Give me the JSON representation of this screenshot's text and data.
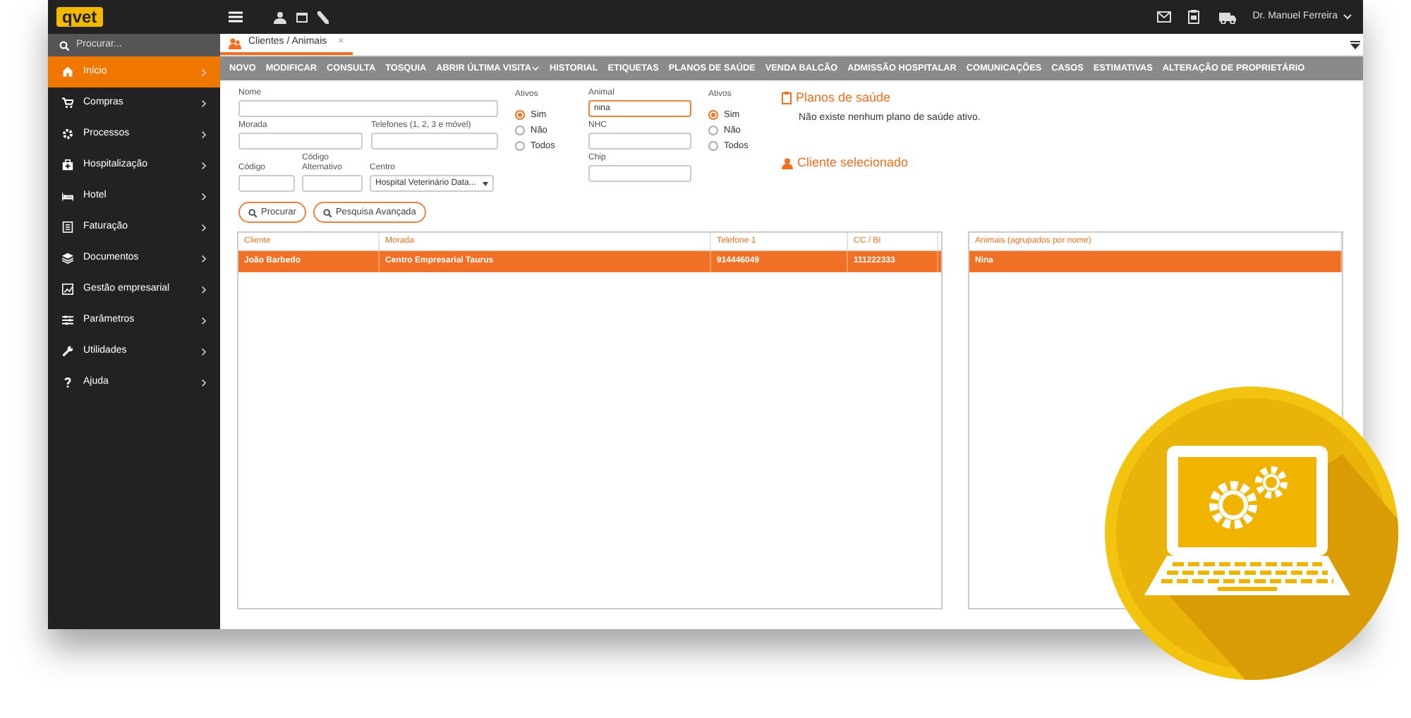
{
  "header": {
    "logo": "qvet",
    "user": "Dr. Manuel Ferreira"
  },
  "sidebar": {
    "search_placeholder": "Procurar...",
    "items": [
      {
        "label": "Início",
        "selected": true
      },
      {
        "label": "Compras",
        "selected": false
      },
      {
        "label": "Processos",
        "selected": false
      },
      {
        "label": "Hospitalização",
        "selected": false
      },
      {
        "label": "Hotel",
        "selected": false
      },
      {
        "label": "Faturação",
        "selected": false
      },
      {
        "label": "Documentos",
        "selected": false
      },
      {
        "label": "Gestão empresarial",
        "selected": false
      },
      {
        "label": "Parâmetros",
        "selected": false
      },
      {
        "label": "Utilidades",
        "selected": false
      },
      {
        "label": "Ajuda",
        "selected": false
      }
    ]
  },
  "tab": {
    "label": "Clientes / Animais",
    "close": "×"
  },
  "toolbar": [
    {
      "label": "NOVO",
      "dropdown": false
    },
    {
      "label": "MODIFICAR",
      "dropdown": false
    },
    {
      "label": "CONSULTA",
      "dropdown": false
    },
    {
      "label": "TOSQUIA",
      "dropdown": false
    },
    {
      "label": "ABRIR ÚLTIMA VISITA",
      "dropdown": true
    },
    {
      "label": "HISTORIAL",
      "dropdown": false
    },
    {
      "label": "ETIQUETAS",
      "dropdown": false
    },
    {
      "label": "PLANOS DE SAÚDE",
      "dropdown": false
    },
    {
      "label": "VENDA BALCÃO",
      "dropdown": false
    },
    {
      "label": "ADMISSÃO HOSPITALAR",
      "dropdown": false
    },
    {
      "label": "COMUNICAÇÕES",
      "dropdown": false
    },
    {
      "label": "CASOS",
      "dropdown": false
    },
    {
      "label": "ESTIMATIVAS",
      "dropdown": false
    },
    {
      "label": "ALTERAÇÃO DE PROPRIETÁRIO",
      "dropdown": false
    }
  ],
  "client_fields": [
    {
      "label": "Nome",
      "kind": "text",
      "focused": false
    },
    {
      "label": "Morada",
      "kind": "text",
      "focused": false
    },
    {
      "label": "Telefones (1, 2, 3 e móvel)",
      "kind": "text",
      "focused": false
    },
    {
      "label": "Código",
      "kind": "text",
      "focused": false
    },
    {
      "label": "Código Alternativo",
      "kind": "text",
      "focused": false
    },
    {
      "label": "Centro",
      "kind": "select",
      "value": "Hospital Veterinário Data...",
      "focused": false
    }
  ],
  "client_active": {
    "label": "Ativos",
    "options": [
      {
        "label": "Sim",
        "selected": true
      },
      {
        "label": "Não",
        "selected": false
      },
      {
        "label": "Todos",
        "selected": false
      }
    ]
  },
  "animal_fields": [
    {
      "label": "Animal",
      "kind": "text",
      "value": "nina",
      "focused": true
    },
    {
      "label": "NHC",
      "kind": "text",
      "focused": false
    },
    {
      "label": "Chip",
      "kind": "text",
      "focused": false
    }
  ],
  "animal_active": {
    "label": "Ativos",
    "options": [
      {
        "label": "Sim",
        "selected": true
      },
      {
        "label": "Não",
        "selected": false
      },
      {
        "label": "Todos",
        "selected": false
      }
    ]
  },
  "health_plans": {
    "title": "Planos de saúde",
    "message": "Não existe nenhum plano de saúde ativo."
  },
  "selected_client": {
    "title": "Cliente selecionado"
  },
  "buttons": [
    "Procurar",
    "Pesquisa Avançada"
  ],
  "clients_table": {
    "columns": [
      "Cliente",
      "Morada",
      "Telefone 1",
      "CC / BI"
    ],
    "rows": [
      {
        "cells": [
          "João Barbedo",
          "Centro Empresarial Taurus",
          "914446049",
          "111222333"
        ],
        "selected": true
      }
    ]
  },
  "animals_table": {
    "columns": [
      "Animais (agrupados por nome)"
    ],
    "rows": [
      {
        "cells": [
          "Nina"
        ],
        "selected": true
      }
    ]
  }
}
